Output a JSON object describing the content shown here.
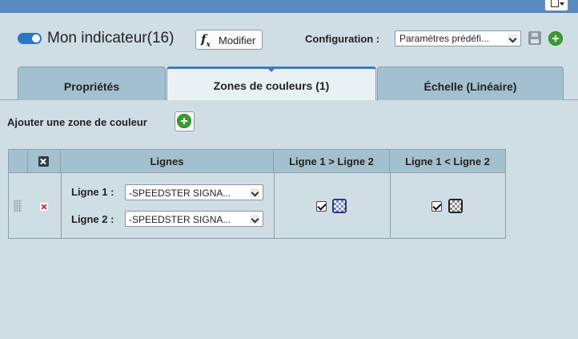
{
  "header": {
    "toggle_on": true,
    "title": "Mon indicateur(16)",
    "formula_button": {
      "icon": "function-fx-icon",
      "label": "Modifier"
    },
    "config_label": "Configuration :",
    "config_select_value": "Paramètres prédéfi...",
    "save_icon": "save-disk-icon",
    "add_icon": "add-circle-icon"
  },
  "tabs": [
    {
      "label": "Propriétés",
      "active": false
    },
    {
      "label": "Zones de couleurs (1)",
      "active": true
    },
    {
      "label": "Échelle (Linéaire)",
      "active": false
    }
  ],
  "zones": {
    "add_label": "Ajouter une zone de couleur",
    "table": {
      "headers": [
        "Lignes",
        "Ligne 1 > Ligne 2",
        "Ligne 1 < Ligne 2"
      ],
      "rows": [
        {
          "line1_label": "Ligne 1 :",
          "line1_value": "-SPEEDSTER SIGNA...",
          "line2_label": "Ligne 2 :",
          "line2_value": "-SPEEDSTER SIGNA...",
          "gt_checked": true,
          "gt_color": "#7b83d0",
          "gt_border": "#2e3478",
          "lt_checked": true,
          "lt_color": "#8a8a8a",
          "lt_border": "#222222"
        }
      ]
    }
  },
  "colors": {
    "accent": "#2c76c9",
    "tab_bg": "#a3c0ce",
    "active_tab_bg": "#eaf1f5",
    "page_bg": "#cfdde5",
    "add_green": "#3a9d33",
    "delete_red": "#d43030"
  }
}
